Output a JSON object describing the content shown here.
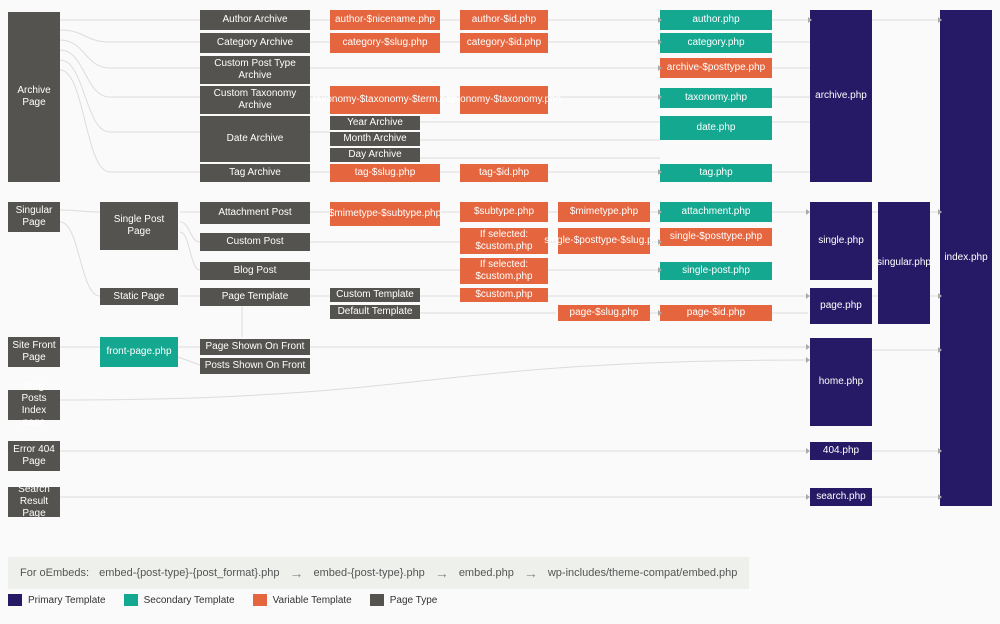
{
  "col1": {
    "archive": "Archive Page",
    "singular": "Singular Page",
    "sitefront": "Site Front Page",
    "blogindex": "Blog Posts Index page",
    "error404": "Error 404 Page",
    "search": "Search Result Page"
  },
  "col2": {
    "singlepost": "Single Post Page",
    "staticpage": "Static Page",
    "frontpage": "front-page.php"
  },
  "col3": {
    "authorarchive": "Author Archive",
    "categoryarchive": "Category Archive",
    "cptarchive": "Custom Post Type Archive",
    "cttarchive": "Custom Taxonomy Archive",
    "datearchive": "Date Archive",
    "tagarchive": "Tag Archive",
    "attachment": "Attachment Post",
    "custompost": "Custom Post",
    "blogpost": "Blog Post",
    "pagetemplate": "Page Template",
    "pageshown": "Page Shown On Front",
    "postsshown": "Posts Shown On Front"
  },
  "col4": {
    "authornice": "author-$nicename.php",
    "categoryslug": "category-$slug.php",
    "taxonomyterm": "taxonomy-$taxonomy-$term.php",
    "yeararchive": "Year Archive",
    "montharchive": "Month Archive",
    "dayarchive": "Day Archive",
    "tagslug": "tag-$slug.php",
    "mimesubtype": "$mimetype-$subtype.php",
    "customtemplate": "Custom Template",
    "defaulttemplate": "Default Template"
  },
  "col5": {
    "authorid": "author-$id.php",
    "categoryid": "category-$id.php",
    "taxonomy": "taxonomy-$taxonomy.php",
    "tagid": "tag-$id.php",
    "subtype": "$subtype.php",
    "ifselected1": "If selected: $custom.php",
    "ifselected2": "If selected: $custom.php",
    "custom": "$custom.php"
  },
  "col6": {
    "mimetype": "$mimetype.php",
    "singleposttype": "single-$posttype-$slug.php",
    "pageslug": "page-$slug.php"
  },
  "col7": {
    "author": "author.php",
    "category": "category.php",
    "archiveposttype": "archive-$posttype.php",
    "taxonomy": "taxonomy.php",
    "date": "date.php",
    "tag": "tag.php",
    "attachment": "attachment.php",
    "singleposttype": "single-$posttype.php",
    "singlepost": "single-post.php",
    "pageid": "page-$id.php"
  },
  "col8": {
    "archive": "archive.php",
    "single": "single.php",
    "page": "page.php",
    "home": "home.php",
    "404": "404.php",
    "search": "search.php"
  },
  "col9": {
    "singular": "singular.php"
  },
  "col10": {
    "index": "index.php"
  },
  "footer": {
    "label": "For oEmbeds:",
    "step1": "embed-{post-type}-{post_format}.php",
    "step2": "embed-{post-type}.php",
    "step3": "embed.php",
    "step4": "wp-includes/theme-compat/embed.php"
  },
  "legend": {
    "primary": "Primary Template",
    "secondary": "Secondary Template",
    "variable": "Variable Template",
    "pagetype": "Page Type"
  }
}
